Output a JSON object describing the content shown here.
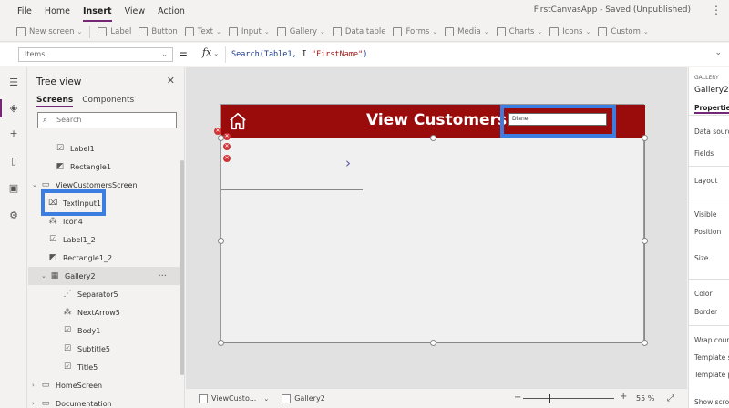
{
  "menu": {
    "items": [
      "File",
      "Home",
      "Insert",
      "View",
      "Action"
    ],
    "active": "Insert",
    "app_title": "FirstCanvasApp - Saved (Unpublished)",
    "more": "⋮"
  },
  "toolbar": {
    "items": [
      {
        "label": "New screen",
        "chevron": true
      },
      {
        "label": "Label",
        "chevron": false
      },
      {
        "label": "Button",
        "chevron": false
      },
      {
        "label": "Text",
        "chevron": true
      },
      {
        "label": "Input",
        "chevron": true
      },
      {
        "label": "Gallery",
        "chevron": true
      },
      {
        "label": "Data table",
        "chevron": false
      },
      {
        "label": "Forms",
        "chevron": true
      },
      {
        "label": "Media",
        "chevron": true
      },
      {
        "label": "Charts",
        "chevron": true
      },
      {
        "label": "Icons",
        "chevron": true
      },
      {
        "label": "Custom",
        "chevron": true
      }
    ]
  },
  "formula": {
    "property": "Items",
    "eq": "=",
    "fx": "fx",
    "code_prefix": "Search(Table1, ",
    "code_string": "\"FirstName\"",
    "code_suffix": ")"
  },
  "tree": {
    "title": "Tree view",
    "tabs": [
      "Screens",
      "Components"
    ],
    "search_placeholder": "Search",
    "rows": [
      {
        "label": "Label1",
        "icon": "label-icon",
        "indent": 2,
        "expander": ""
      },
      {
        "label": "Rectangle1",
        "icon": "rectangle-icon",
        "indent": 2,
        "expander": ""
      },
      {
        "label": "ViewCustomersScreen",
        "icon": "screen-icon",
        "indent": 0,
        "expander": "⌄"
      },
      {
        "label": "TextInput1",
        "icon": "text-input-icon",
        "indent": 1,
        "expander": ""
      },
      {
        "label": "Icon4",
        "icon": "icon-control-icon",
        "indent": 1,
        "expander": ""
      },
      {
        "label": "Label1_2",
        "icon": "label-icon",
        "indent": 1,
        "expander": ""
      },
      {
        "label": "Rectangle1_2",
        "icon": "rectangle-icon",
        "indent": 1,
        "expander": ""
      },
      {
        "label": "Gallery2",
        "icon": "gallery-icon",
        "indent": 1,
        "expander": "⌄",
        "selected": true
      },
      {
        "label": "Separator5",
        "icon": "separator-icon",
        "indent": 2,
        "expander": ""
      },
      {
        "label": "NextArrow5",
        "icon": "arrow-icon",
        "indent": 2,
        "expander": ""
      },
      {
        "label": "Body1",
        "icon": "label-icon",
        "indent": 2,
        "expander": ""
      },
      {
        "label": "Subtitle5",
        "icon": "label-icon",
        "indent": 2,
        "expander": ""
      },
      {
        "label": "Title5",
        "icon": "label-icon",
        "indent": 2,
        "expander": ""
      },
      {
        "label": "HomeScreen",
        "icon": "screen-icon",
        "indent": 0,
        "expander": "›"
      },
      {
        "label": "Documentation",
        "icon": "screen-icon",
        "indent": 0,
        "expander": "›"
      }
    ],
    "row_more": "···"
  },
  "canvas": {
    "title": "View Customers",
    "search_value": "Diane",
    "next_arrow": "›"
  },
  "properties": {
    "type": "GALLERY",
    "name": "Gallery2",
    "tab": "Properties",
    "labels": [
      "Data source",
      "Fields",
      "Layout",
      "Visible",
      "Position",
      "Size",
      "Color",
      "Border",
      "Wrap count",
      "Template size",
      "Template padding",
      "Show scrollbar"
    ]
  },
  "status": {
    "screen": "ViewCusto...",
    "control": "Gallery2",
    "zoom_value": "55",
    "zoom_unit": "%",
    "minus": "−",
    "plus": "+"
  },
  "colors": {
    "accent": "#742774",
    "header": "#9a0b0b",
    "highlight": "#3b7de0",
    "error": "#d13438"
  }
}
